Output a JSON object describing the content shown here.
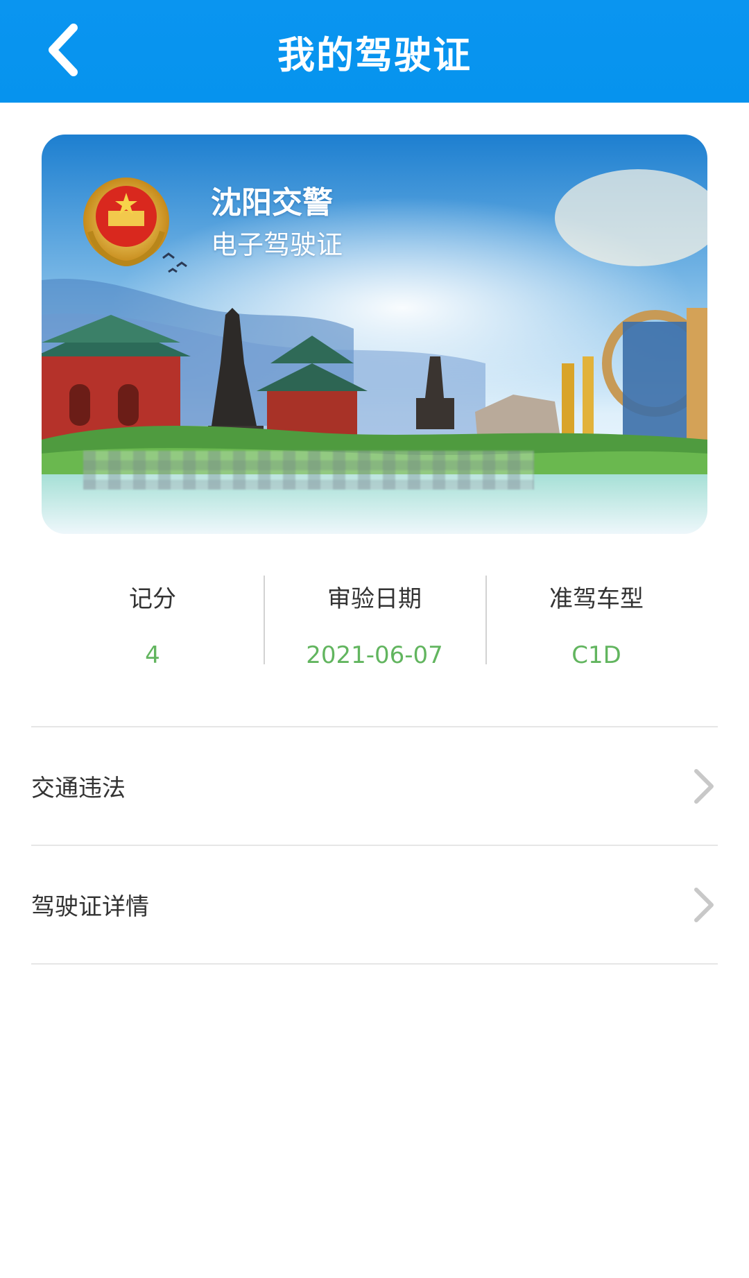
{
  "header": {
    "title": "我的驾驶证",
    "back_icon": "chevron-left-icon"
  },
  "card": {
    "title": "沈阳交警",
    "subtitle": "电子驾驶证",
    "emblem_icon": "police-emblem-icon"
  },
  "stats": [
    {
      "label": "记分",
      "value": "4"
    },
    {
      "label": "审验日期",
      "value": "2021-06-07"
    },
    {
      "label": "准驾车型",
      "value": "C1D"
    }
  ],
  "menu": [
    {
      "label": "交通违法",
      "icon": "chevron-right-icon"
    },
    {
      "label": "驾驶证详情",
      "icon": "chevron-right-icon"
    }
  ],
  "colors": {
    "header_bg": "#0693ee",
    "value_green": "#62b55f",
    "text_dark": "#333333",
    "divider": "#e6e6e6"
  }
}
